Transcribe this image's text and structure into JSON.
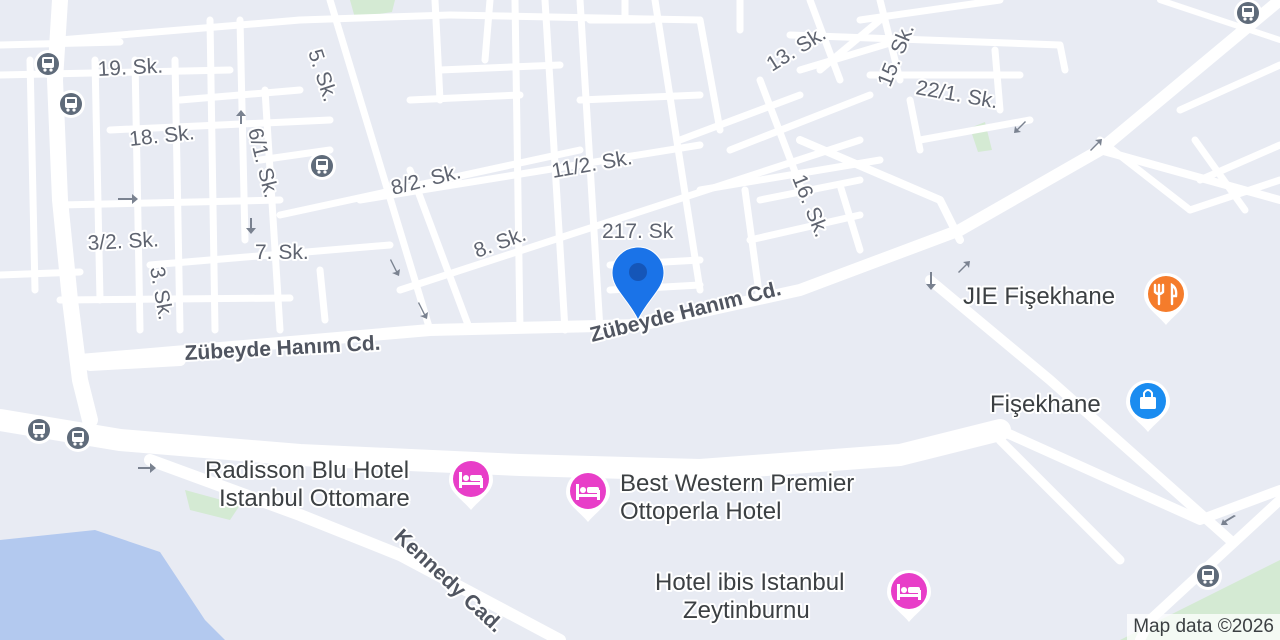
{
  "map": {
    "streets": {
      "s19": "19. Sk.",
      "s5": "5. Sk.",
      "s18": "18. Sk.",
      "s6_1": "6/1. Sk.",
      "s8_2": "8/2. Sk.",
      "s11_2": "11/2. Sk.",
      "s13": "13. Sk.",
      "s15": "15. Sk.",
      "s22_1": "22/1. Sk.",
      "s16": "16. Sk.",
      "s217": "217. Sk",
      "s8": "8. Sk.",
      "s7": "7. Sk.",
      "s3_2": "3/2. Sk.",
      "s3": "3. Sk.",
      "zubeyde_west": "Zübeyde Hanım Cd.",
      "zubeyde_east": "Zübeyde Hanım Cd.",
      "kennedy": "Kennedy Cad."
    },
    "pois": {
      "jie": {
        "label": "JIE Fişekhane",
        "icon": "restaurant-icon",
        "color": "#f57c2b"
      },
      "fisekhane": {
        "label": "Fişekhane",
        "icon": "shopping-bag-icon",
        "color": "#1a8cf0"
      },
      "radisson": {
        "line1": "Radisson Blu Hotel",
        "line2": "Istanbul Ottomare",
        "icon": "hotel-bed-icon",
        "color": "#e83ec8"
      },
      "bestwestern": {
        "line1": "Best Western Premier",
        "line2": "Ottoperla Hotel",
        "icon": "hotel-bed-icon",
        "color": "#e83ec8"
      },
      "ibis": {
        "line1": "Hotel ibis Istanbul",
        "line2": "Zeytinburnu",
        "icon": "hotel-bed-icon",
        "color": "#e83ec8"
      }
    },
    "location_pin": {
      "icon": "location-pin-icon",
      "color": "#1a73e8"
    },
    "transit_icon": "bus-stop-icon",
    "colors": {
      "land": "#e8ebf3",
      "road": "#ffffff",
      "water": "#b3c9ef",
      "park": "#d4ead3"
    },
    "attribution": "Map data ©2026"
  }
}
